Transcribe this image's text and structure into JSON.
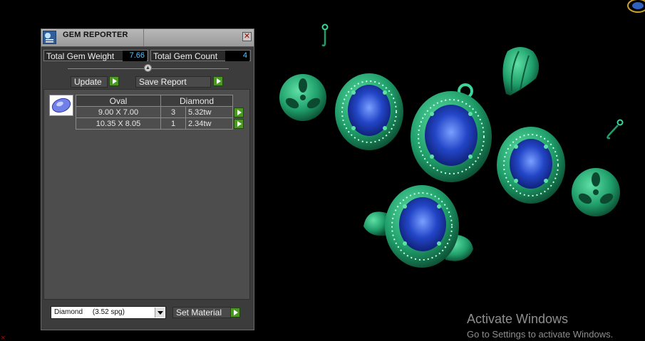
{
  "panel": {
    "title": "GEM REPORTER",
    "close_glyph": "✕",
    "total_weight_label": "Total Gem Weight",
    "total_weight_value": "7.66",
    "total_count_label": "Total Gem Count",
    "total_count_value": "4",
    "update_label": "Update",
    "save_report_label": "Save Report",
    "table": {
      "headers": [
        "Oval",
        "Diamond"
      ],
      "rows": [
        {
          "size": "9.00 X 7.00",
          "count": "3",
          "weight": "5.32tw"
        },
        {
          "size": "10.35 X 8.05",
          "count": "1",
          "weight": "2.34tw"
        }
      ]
    },
    "material_select_value": "Diamond     (3.52 spg)",
    "set_material_label": "Set Material"
  },
  "watermark": {
    "line1": "Activate Windows",
    "line2": "Go to Settings to activate Windows."
  },
  "colors": {
    "metal": "#1f9e6a",
    "metal_light": "#5fe0a6",
    "sapphire": "#2346c8",
    "accent_blue": "#57c4ff",
    "button_green": "#4a9a22"
  },
  "icons": [
    "gem-reporter-app-icon",
    "close-icon",
    "slider-knob-icon",
    "oval-gem-icon",
    "dropdown-arrow-icon",
    "play-arrow-icon"
  ]
}
